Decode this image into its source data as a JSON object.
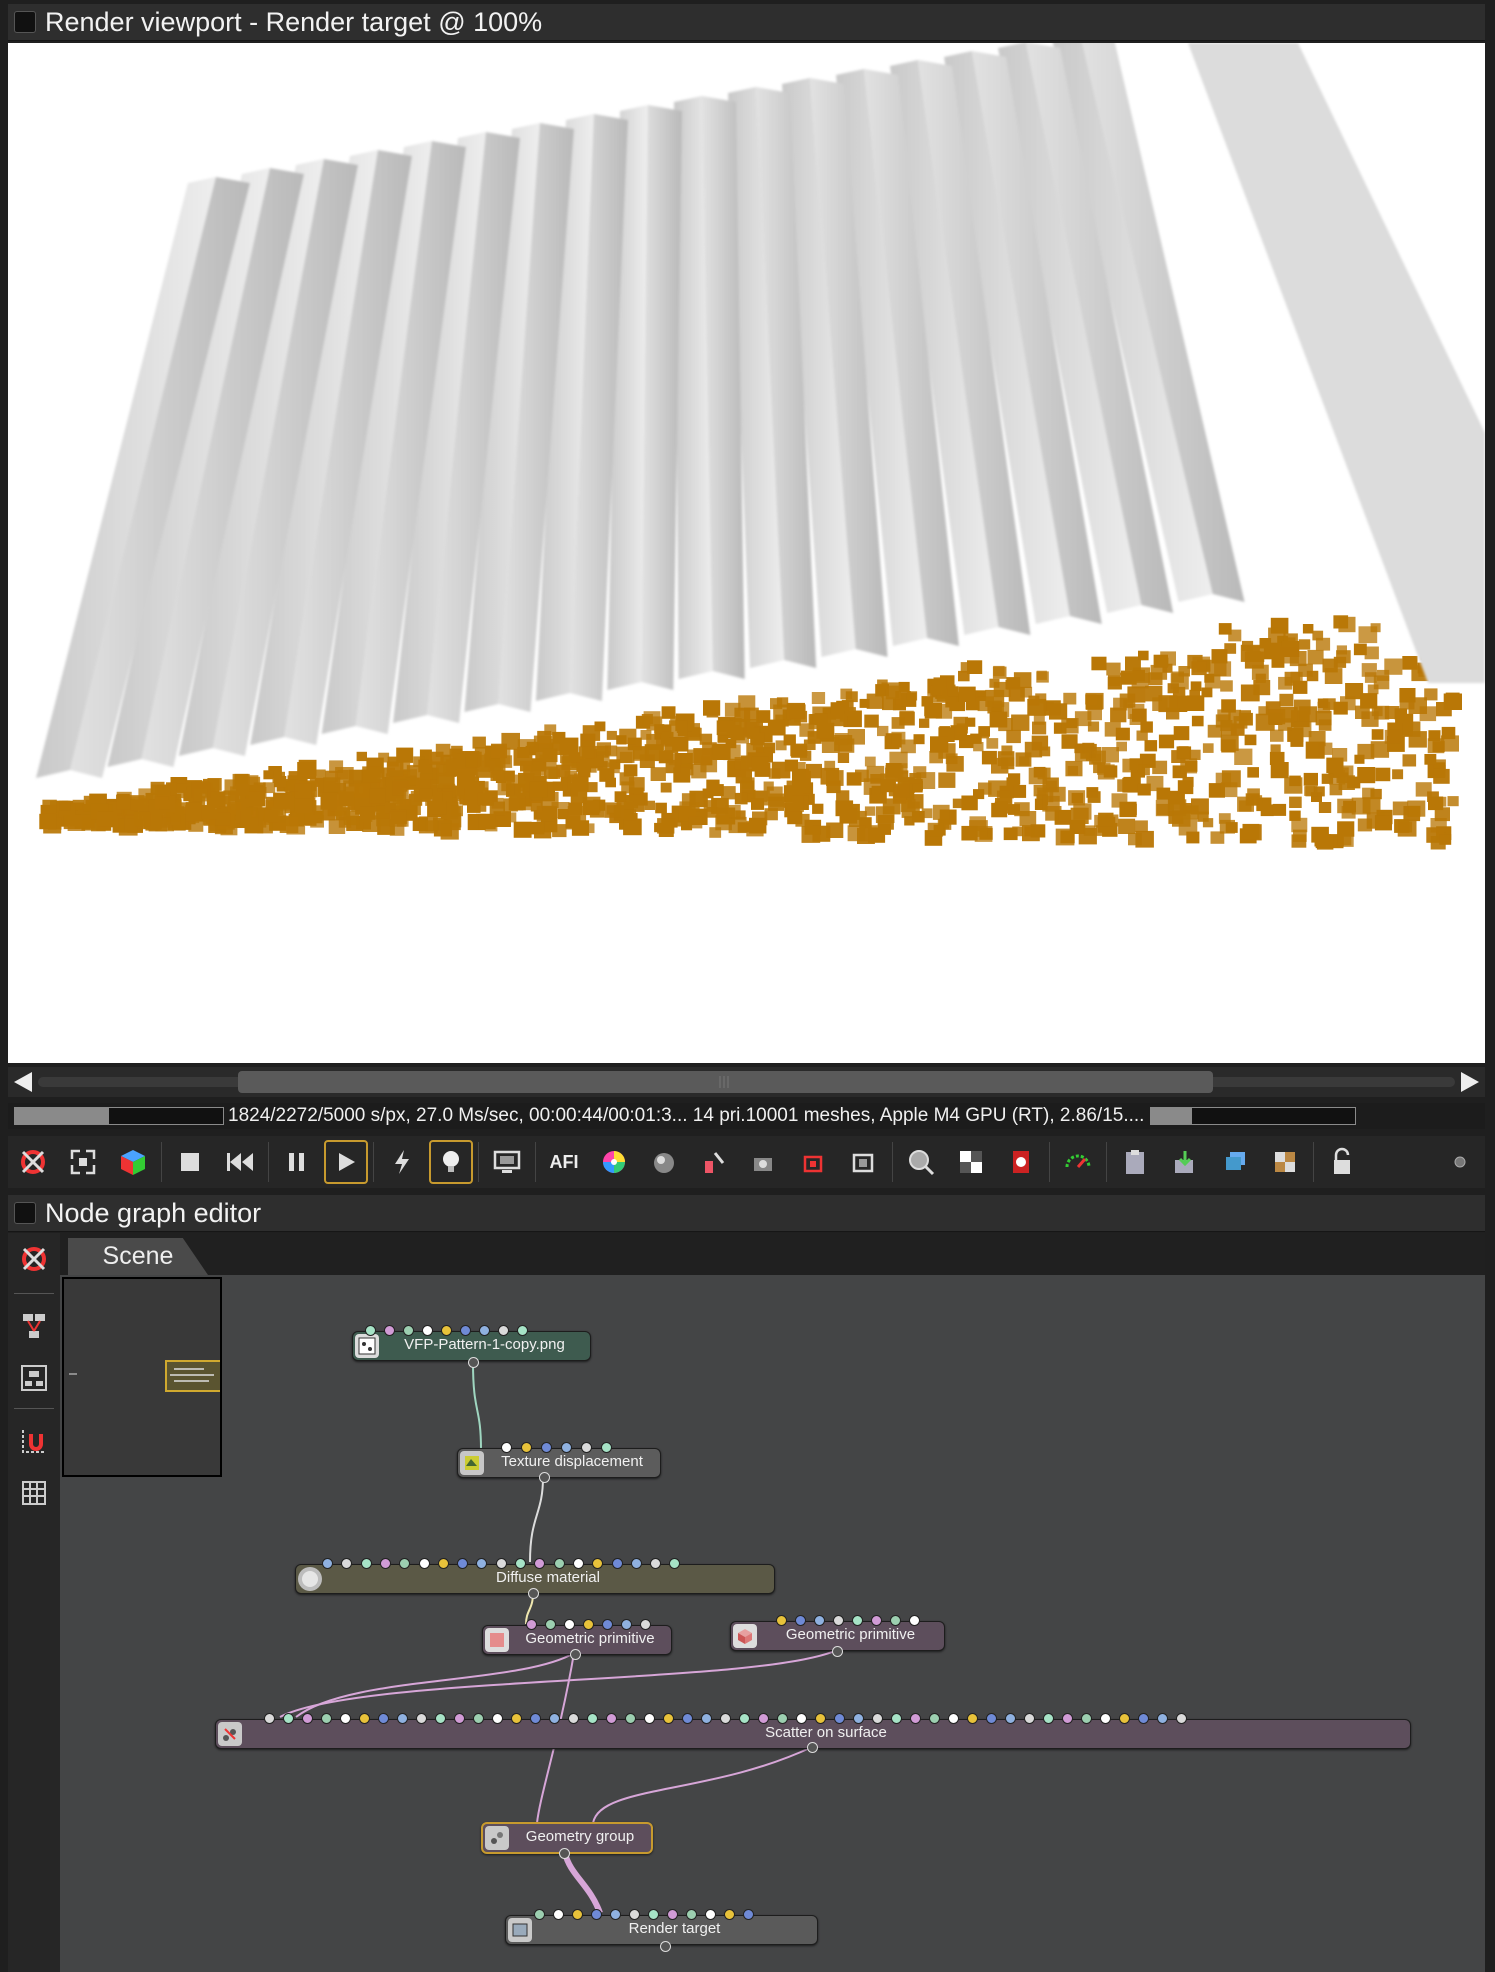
{
  "viewport": {
    "title": "Render viewport - Render target @ 100%",
    "status_text": "1824/2272/5000 s/px, 27.0 Ms/sec, 00:00:44/00:01:3... 14 pri.10001 meshes, Apple M4 GPU (RT), 2.86/15....",
    "progress_left": 0.45,
    "progress_right": 0.2,
    "toolbar_icons": [
      "recenter-view-icon",
      "fit-view-icon",
      "cube-color-icon",
      "stop-icon",
      "rewind-icon",
      "pause-icon",
      "play-icon",
      "lightning-icon",
      "lightbulb-icon",
      "display-icon",
      "afi-icon",
      "color-wheel-icon",
      "sphere-pick-icon",
      "material-picker-icon",
      "camera-pick-icon",
      "region-render-icon",
      "film-region-icon",
      "zoom-icon",
      "checker-icon",
      "render-pass-icon",
      "gauge-icon",
      "clipboard-icon",
      "export-icon",
      "layers-icon",
      "texture-icon",
      "lock-icon",
      "dot-icon"
    ]
  },
  "node_editor": {
    "title": "Node graph editor",
    "tab": "Scene",
    "nodes": [
      {
        "id": "vfp",
        "label": "VFP-Pattern-1-copy.png",
        "icon": "image-node-icon"
      },
      {
        "id": "texdisp",
        "label": "Texture displacement",
        "icon": "displacement-icon"
      },
      {
        "id": "diffuse",
        "label": "Diffuse material",
        "icon": "material-sphere-icon"
      },
      {
        "id": "geo1",
        "label": "Geometric primitive",
        "icon": "square-primitive-icon"
      },
      {
        "id": "geo2",
        "label": "Geometric primitive",
        "icon": "cube-primitive-icon"
      },
      {
        "id": "scatter",
        "label": "Scatter on surface",
        "icon": "scatter-icon"
      },
      {
        "id": "group",
        "label": "Geometry group",
        "icon": "group-icon"
      },
      {
        "id": "target",
        "label": "Render target",
        "icon": "render-target-icon"
      }
    ],
    "left_tools": [
      "recenter-icon",
      "tree-layout-icon",
      "node-layout-icon",
      "magnet-grid-icon",
      "grid-icon"
    ]
  },
  "colors": {
    "accent": "#c79a2e",
    "fin": "#d7d7d7",
    "cubes": "#b97706",
    "wire_pink": "#d7a6d8",
    "wire_teal": "#9fd6c0"
  }
}
